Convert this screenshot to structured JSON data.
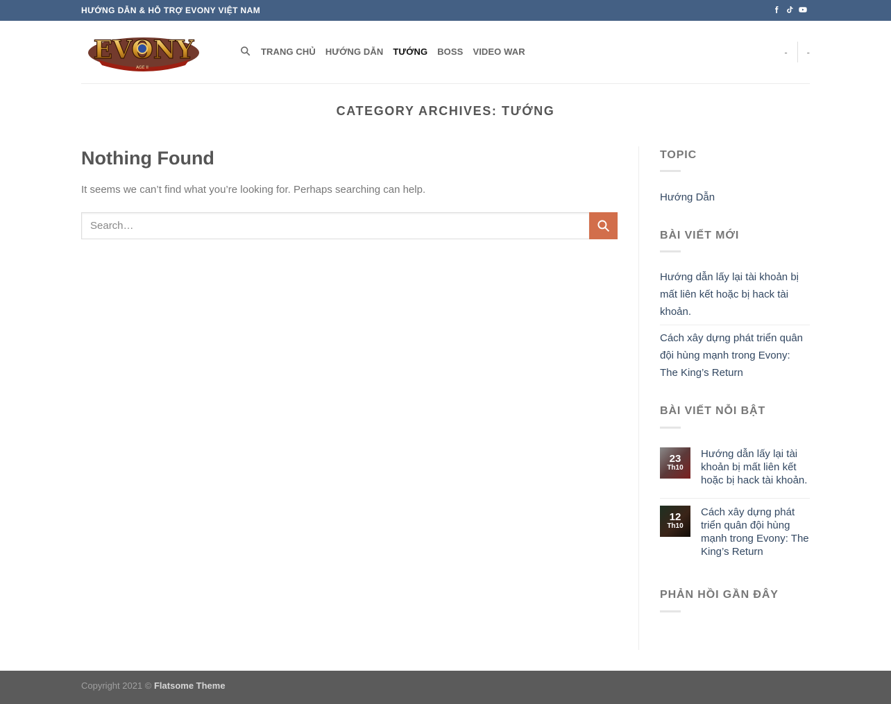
{
  "topbar": {
    "text": "HƯỚNG DẪN & HỖ TRỢ EVONY VIỆT NAM",
    "social": [
      "facebook-icon",
      "tiktok-icon",
      "youtube-icon"
    ]
  },
  "logo": {
    "text": "EVONY",
    "subtext": "AGE II"
  },
  "nav": {
    "items": [
      {
        "label": "TRANG CHỦ",
        "active": false
      },
      {
        "label": "HƯỚNG DẪN",
        "active": false
      },
      {
        "label": "TƯỚNG",
        "active": true
      },
      {
        "label": "BOSS",
        "active": false
      },
      {
        "label": "VIDEO WAR",
        "active": false
      }
    ],
    "right": [
      "-",
      "-"
    ]
  },
  "page_title": "CATEGORY ARCHIVES: TƯỚNG",
  "main": {
    "title": "Nothing Found",
    "text": "It seems we can’t find what you’re looking for. Perhaps searching can help.",
    "search_placeholder": "Search…"
  },
  "sidebar": {
    "topic": {
      "title": "TOPIC",
      "items": [
        "Hướng Dẫn"
      ]
    },
    "recent": {
      "title": "BÀI VIẾT MỚI",
      "items": [
        "Hướng dẫn lấy lại tài khoản bị mất liên kết hoặc bị hack tài khoản.",
        "Cách xây dựng phát triển quân đội hùng mạnh trong Evony: The King’s Return"
      ]
    },
    "featured": {
      "title": "BÀI VIẾT NỖI BẬT",
      "items": [
        {
          "day": "23",
          "month": "Th10",
          "title": "Hướng dẫn lấy lại tài khoản bị mất liên kết hoặc bị hack tài khoản."
        },
        {
          "day": "12",
          "month": "Th10",
          "title": "Cách xây dựng phát triển quân đội hùng mạnh trong Evony: The King’s Return"
        }
      ]
    },
    "comments": {
      "title": "PHẢN HỒI GẦN ĐÂY"
    }
  },
  "footer": {
    "copyright": "Copyright 2021 © ",
    "theme": "Flatsome Theme"
  },
  "colors": {
    "topbar": "#446084",
    "accent": "#d26e4b",
    "link": "#334862",
    "footer": "#5b5b5b"
  }
}
